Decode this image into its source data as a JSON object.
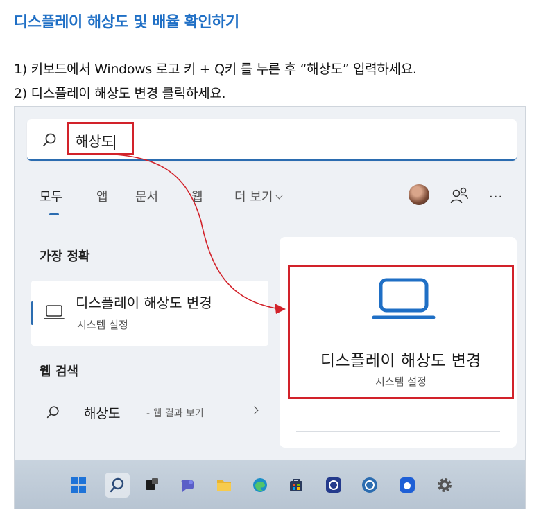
{
  "page": {
    "title": "디스플레이 해상도 및 배율 확인하기",
    "step1": "1) 키보드에서 Windows 로고 키 + Q키 를 누른 후 “해상도” 입력하세요.",
    "step2": "2) 디스플레이 해상도 변경 클릭하세요."
  },
  "search": {
    "query": "해상도"
  },
  "tabs": [
    {
      "label": "모두",
      "active": true
    },
    {
      "label": "앱"
    },
    {
      "label": "문서"
    },
    {
      "label": "웹"
    },
    {
      "label": "더 보기"
    }
  ],
  "header_icons": [
    "avatar",
    "people-icon",
    "more-icon"
  ],
  "more_glyph": "···",
  "best_match": {
    "label": "가장 정확",
    "title": "디스플레이 해상도 변경",
    "subtitle": "시스템 설정",
    "icon": "laptop-icon"
  },
  "web_search": {
    "label": "웹 검색",
    "term": "해상도",
    "suffix": "- 웹 결과 보기"
  },
  "preview": {
    "title": "디스플레이 해상도 변경",
    "subtitle": "시스템 설정",
    "icon": "laptop-icon"
  },
  "taskbar": {
    "icons": [
      "windows-start-icon",
      "search-icon",
      "task-view-icon",
      "chat-icon",
      "file-explorer-icon",
      "edge-icon",
      "store-icon",
      "app-icon",
      "app-icon-2",
      "app-icon-3",
      "settings-icon"
    ]
  },
  "colors": {
    "title_blue": "#1f6fc5",
    "highlight_red": "#d2222a",
    "accent": "#2b6cb0"
  }
}
